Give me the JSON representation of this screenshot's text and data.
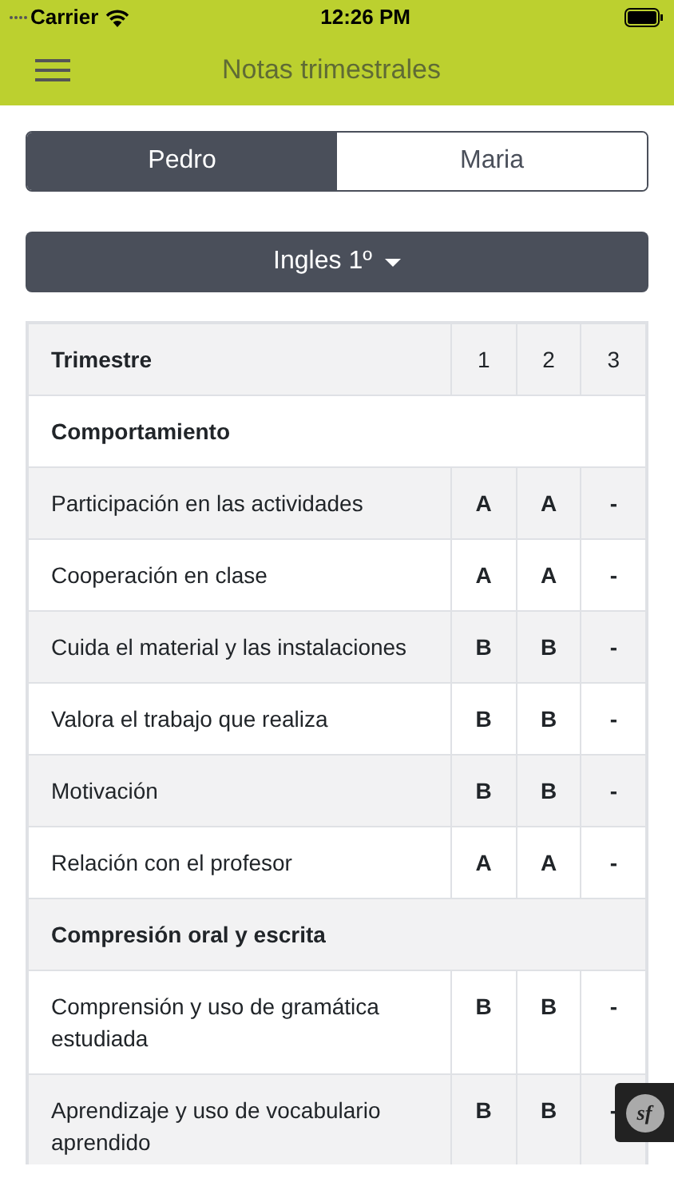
{
  "status_bar": {
    "carrier": "Carrier",
    "time": "12:26 PM"
  },
  "header": {
    "title": "Notas trimestrales"
  },
  "tabs": [
    {
      "label": "Pedro",
      "selected": true
    },
    {
      "label": "Maria",
      "selected": false
    }
  ],
  "subject_dropdown": {
    "label": "Ingles 1º"
  },
  "table": {
    "columns": [
      "Trimestre",
      "1",
      "2",
      "3"
    ],
    "rows": [
      {
        "kind": "section",
        "label": "Comportamiento"
      },
      {
        "kind": "item",
        "label": "Participación en las actividades",
        "grades": [
          "A",
          "A",
          "-"
        ]
      },
      {
        "kind": "item",
        "label": "Cooperación en clase",
        "grades": [
          "A",
          "A",
          "-"
        ]
      },
      {
        "kind": "item",
        "label": "Cuida el material y las instalaciones",
        "grades": [
          "B",
          "B",
          "-"
        ]
      },
      {
        "kind": "item",
        "label": "Valora el trabajo que realiza",
        "grades": [
          "B",
          "B",
          "-"
        ]
      },
      {
        "kind": "item",
        "label": "Motivación",
        "grades": [
          "B",
          "B",
          "-"
        ]
      },
      {
        "kind": "item",
        "label": "Relación con el profesor",
        "grades": [
          "A",
          "A",
          "-"
        ]
      },
      {
        "kind": "section",
        "label": "Compresión oral y escrita"
      },
      {
        "kind": "item",
        "label": "Comprensión y uso de gramática estudiada",
        "grades": [
          "B",
          "B",
          "-"
        ]
      },
      {
        "kind": "item",
        "label": "Aprendizaje y uso de vocabulario aprendido",
        "grades": [
          "B",
          "B",
          "-"
        ]
      }
    ]
  },
  "debug_toolbar": {
    "label": "sf"
  }
}
